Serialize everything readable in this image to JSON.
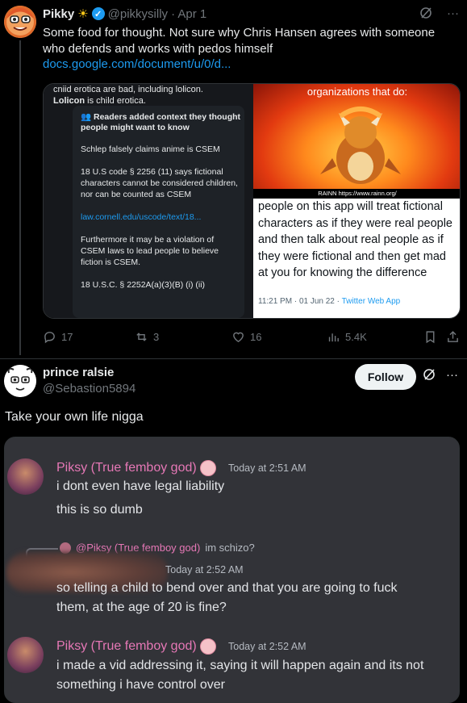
{
  "tweet1": {
    "name": "Pikky",
    "handle": "@pikkysilly",
    "date": "· Apr 1",
    "text": "Some food for thought. Not sure why Chris Hansen agrees with someone who defends and works with pedos himself",
    "link": "docs.google.com/document/u/0/d...",
    "media": {
      "left_top_line1": "cniid erotica are bad, including lolicon.",
      "left_top_line2_bold": "Lolicon",
      "left_top_line2_rest": " is child erotica.",
      "note_header": "Readers added context they thought people might want to know",
      "note_paragraphs": [
        "Schlep falsely claims anime is CSEM",
        "18 U.S code § 2256 (11) says fictional characters cannot be considered children, nor can be counted as CSEM",
        "law.cornell.edu/uscode/text/18...",
        "Furthermore it may be a violation of CSEM laws to lead people to believe fiction is CSEM.",
        "18 U.S.C. § 2252A(a)(3)(B) (i) (ii)"
      ],
      "right_top_caption": "organizations that do:",
      "rainn_caption": "RAINN https://www.rainn.org/",
      "right_bottom_text": "people on this app will treat fictional characters as if they were real people and then talk about real people as if they were fictional and then get mad at you for knowing the difference",
      "right_bottom_meta": "11:21 PM · 01 Jun 22 · ",
      "right_bottom_source": "Twitter Web App"
    },
    "actions": {
      "replies": "17",
      "reposts": "3",
      "likes": "16",
      "views": "5.4K"
    }
  },
  "tweet2": {
    "name": "prince ralsie",
    "handle": "@Sebastion5894",
    "follow_label": "Follow",
    "text": "Take your own life nigga"
  },
  "discord": {
    "msg1_name": "Piksy (True femboy god)",
    "msg1_time": "Today at 2:51 AM",
    "msg1_lines": [
      "i dont even have legal liability",
      "this is so dumb"
    ],
    "reply_ref_name": "@Piksy (True femboy god)",
    "reply_ref_text": "im schizo?",
    "msg2_time": "Today at 2:52 AM",
    "msg2_lines": [
      "so telling a child to bend over and that you are going to fuck",
      "them, at the age of 20 is fine?"
    ],
    "msg3_name": "Piksy (True femboy god)",
    "msg3_time": "Today at 2:52 AM",
    "msg3_lines": [
      "i made a vid addressing it, saying it will happen again and its not",
      "something i have control over"
    ]
  }
}
